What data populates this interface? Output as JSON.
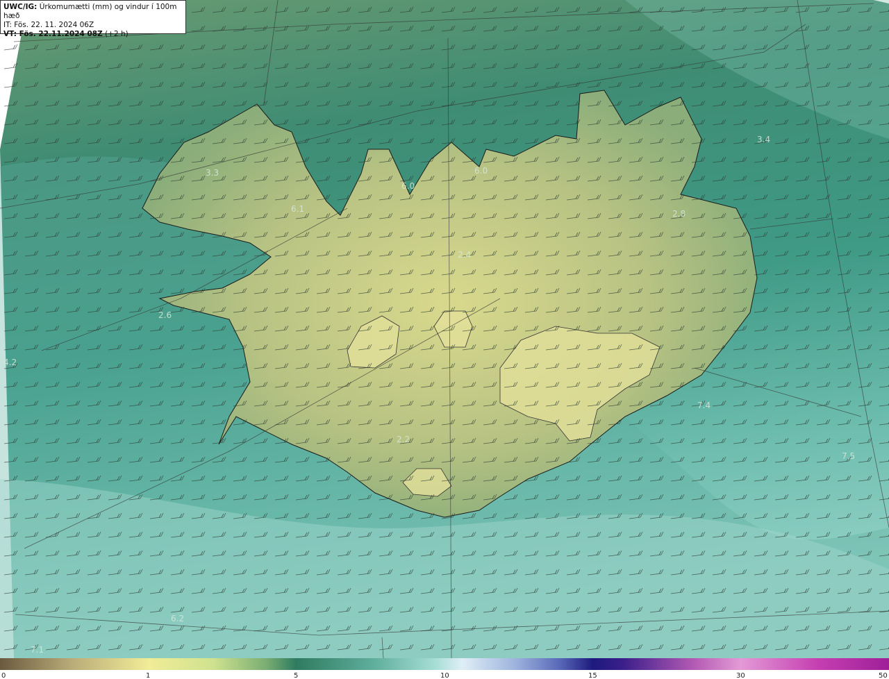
{
  "header": {
    "line1_bold": "UWC/IG:",
    "line1_rest": "Úrkomumætti (mm) og vindur í 100m hæð",
    "line2": "IT: Fös. 22. 11. 2024 06Z",
    "line3_bold": "VT: Fös. 22.11.2024 08Z",
    "line3_rest": "(+2 h)"
  },
  "map_value_labels": [
    "3.3",
    "6.1",
    "6.0",
    "6.0",
    "2.4",
    "2.8",
    "3.4",
    "2.6",
    "4.2",
    "2.2",
    "7.4",
    "7.5",
    "6.2",
    "7.1"
  ],
  "colorbar": {
    "ticks": [
      "0",
      "1",
      "5",
      "10",
      "15",
      "30",
      "50"
    ],
    "colors": [
      "#6b5a3e",
      "#b9ab78",
      "#f1ec97",
      "#cfe28f",
      "#79ad72",
      "#2f7b60",
      "#5fae9c",
      "#a7ded6",
      "#dfeef6",
      "#9db3dd",
      "#5868b8",
      "#1d1a7e",
      "#3a1e8a",
      "#b35ab3",
      "#e39ad6",
      "#c53fb1",
      "#9f1f98"
    ]
  }
}
